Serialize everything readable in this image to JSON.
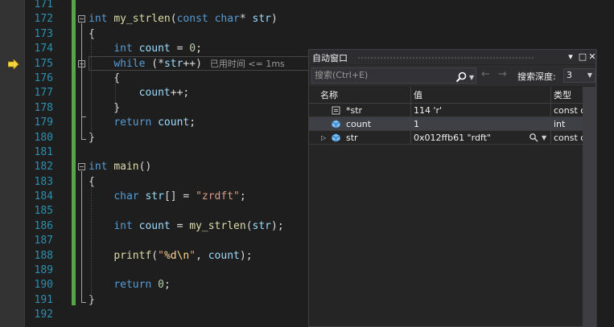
{
  "editor": {
    "current_line": "175",
    "lines": [
      {
        "num": "171",
        "code": []
      },
      {
        "num": "172",
        "code": [
          {
            "t": "kw",
            "s": "int"
          },
          {
            "t": "text",
            "s": " "
          },
          {
            "t": "fn",
            "s": "my_strlen"
          },
          {
            "t": "text",
            "s": "("
          },
          {
            "t": "kw",
            "s": "const"
          },
          {
            "t": "text",
            "s": " "
          },
          {
            "t": "kw",
            "s": "char"
          },
          {
            "t": "text",
            "s": "* "
          },
          {
            "t": "var",
            "s": "str"
          },
          {
            "t": "text",
            "s": ")"
          }
        ]
      },
      {
        "num": "173",
        "code": [
          {
            "t": "text",
            "s": "{"
          }
        ]
      },
      {
        "num": "174",
        "code": [
          {
            "t": "text",
            "s": "    "
          },
          {
            "t": "kw",
            "s": "int"
          },
          {
            "t": "text",
            "s": " "
          },
          {
            "t": "var",
            "s": "count"
          },
          {
            "t": "text",
            "s": " = "
          },
          {
            "t": "num",
            "s": "0"
          },
          {
            "t": "text",
            "s": ";"
          }
        ]
      },
      {
        "num": "175",
        "code": [
          {
            "t": "text",
            "s": "    "
          },
          {
            "t": "kw",
            "s": "while"
          },
          {
            "t": "text",
            "s": " (*"
          },
          {
            "t": "var",
            "s": "str"
          },
          {
            "t": "text",
            "s": "++)"
          }
        ],
        "tip": "已用时间 <= 1ms"
      },
      {
        "num": "176",
        "code": [
          {
            "t": "text",
            "s": "    {"
          }
        ]
      },
      {
        "num": "177",
        "code": [
          {
            "t": "text",
            "s": "        "
          },
          {
            "t": "var",
            "s": "count"
          },
          {
            "t": "text",
            "s": "++;"
          }
        ]
      },
      {
        "num": "178",
        "code": [
          {
            "t": "text",
            "s": "    }"
          }
        ]
      },
      {
        "num": "179",
        "code": [
          {
            "t": "text",
            "s": "    "
          },
          {
            "t": "kw",
            "s": "return"
          },
          {
            "t": "text",
            "s": " "
          },
          {
            "t": "var",
            "s": "count"
          },
          {
            "t": "text",
            "s": ";"
          }
        ]
      },
      {
        "num": "180",
        "code": [
          {
            "t": "text",
            "s": "}"
          }
        ]
      },
      {
        "num": "181",
        "code": []
      },
      {
        "num": "182",
        "code": [
          {
            "t": "kw",
            "s": "int"
          },
          {
            "t": "text",
            "s": " "
          },
          {
            "t": "fn",
            "s": "main"
          },
          {
            "t": "text",
            "s": "()"
          }
        ]
      },
      {
        "num": "183",
        "code": [
          {
            "t": "text",
            "s": "{"
          }
        ]
      },
      {
        "num": "184",
        "code": [
          {
            "t": "text",
            "s": "    "
          },
          {
            "t": "kw",
            "s": "char"
          },
          {
            "t": "text",
            "s": " "
          },
          {
            "t": "var",
            "s": "str"
          },
          {
            "t": "text",
            "s": "[] = "
          },
          {
            "t": "str",
            "s": "\"zrdft\""
          },
          {
            "t": "text",
            "s": ";"
          }
        ]
      },
      {
        "num": "185",
        "code": []
      },
      {
        "num": "186",
        "code": [
          {
            "t": "text",
            "s": "    "
          },
          {
            "t": "kw",
            "s": "int"
          },
          {
            "t": "text",
            "s": " "
          },
          {
            "t": "var",
            "s": "count"
          },
          {
            "t": "text",
            "s": " = "
          },
          {
            "t": "fn",
            "s": "my_strlen"
          },
          {
            "t": "text",
            "s": "("
          },
          {
            "t": "var",
            "s": "str"
          },
          {
            "t": "text",
            "s": ");"
          }
        ]
      },
      {
        "num": "187",
        "code": []
      },
      {
        "num": "188",
        "code": [
          {
            "t": "text",
            "s": "    "
          },
          {
            "t": "fn",
            "s": "printf"
          },
          {
            "t": "text",
            "s": "("
          },
          {
            "t": "str",
            "s": "\""
          },
          {
            "t": "esc",
            "s": "%d\\n"
          },
          {
            "t": "str",
            "s": "\""
          },
          {
            "t": "text",
            "s": ", "
          },
          {
            "t": "var",
            "s": "count"
          },
          {
            "t": "text",
            "s": ");"
          }
        ]
      },
      {
        "num": "189",
        "code": []
      },
      {
        "num": "190",
        "code": [
          {
            "t": "text",
            "s": "    "
          },
          {
            "t": "kw",
            "s": "return"
          },
          {
            "t": "text",
            "s": " "
          },
          {
            "t": "num",
            "s": "0"
          },
          {
            "t": "text",
            "s": ";"
          }
        ]
      },
      {
        "num": "191",
        "code": [
          {
            "t": "text",
            "s": "}"
          }
        ]
      },
      {
        "num": "192",
        "code": []
      }
    ]
  },
  "autos": {
    "title": "自动窗口",
    "search_placeholder": "搜索(Ctrl+E)",
    "depth_label": "搜索深度:",
    "depth_value": "3",
    "columns": {
      "name": "名称",
      "value": "值",
      "type": "类型"
    },
    "rows": [
      {
        "name": "*str",
        "value": "114 'r'",
        "type": "const c...",
        "icon": "pointer-field-icon"
      },
      {
        "name": "count",
        "value": "1",
        "type": "int",
        "icon": "variable-icon"
      },
      {
        "name": "str",
        "value": "0x012ffb61 \"rdft\"",
        "type": "const c...",
        "icon": "variable-icon"
      }
    ]
  }
}
